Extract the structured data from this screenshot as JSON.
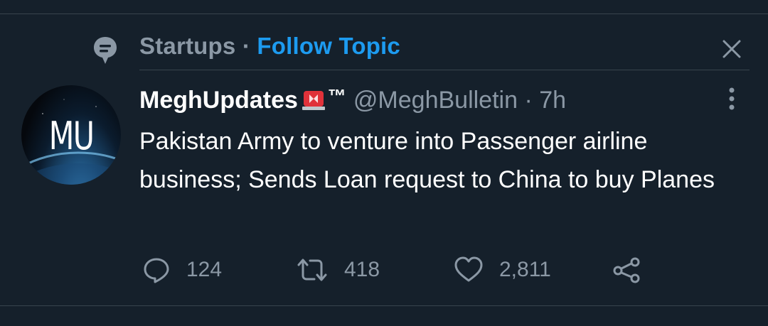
{
  "topic": {
    "name": "Startups",
    "separator": " · ",
    "follow_label": "Follow Topic"
  },
  "tweet": {
    "display_name": "MeghUpdates",
    "badge_emoji": "siren-icon",
    "trademark": "™",
    "handle": "@MeghBulletin",
    "separator": " · ",
    "time": "7h",
    "text": "Pakistan Army to venture into Passenger airline business; Sends Loan request to China to buy Planes",
    "avatar_text": "MU"
  },
  "actions": {
    "reply_count": "124",
    "retweet_count": "418",
    "like_count": "2,811"
  },
  "icons": {
    "topic": "topic-bubble-icon",
    "close": "close-icon",
    "more": "more-vertical-icon",
    "reply": "reply-icon",
    "retweet": "retweet-icon",
    "like": "heart-icon",
    "share": "share-icon"
  },
  "colors": {
    "background": "#15202b",
    "divider": "#38444d",
    "secondary_text": "#8b98a5",
    "accent": "#1d9bf0"
  }
}
